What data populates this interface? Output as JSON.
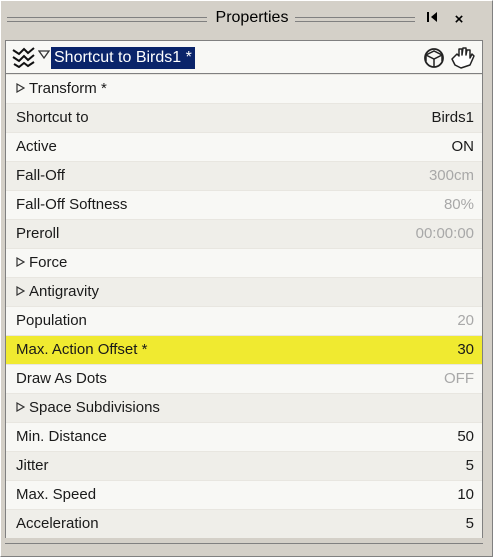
{
  "window": {
    "title": "Properties",
    "pin_label": "◀",
    "close_label": "×"
  },
  "object": {
    "name": "Shortcut to Birds1 *",
    "icon": "flock-icon",
    "tools_icon": "hand-icon"
  },
  "rows": [
    {
      "label": "Transform *",
      "value": "",
      "group": true
    },
    {
      "label": "Shortcut to",
      "value": "Birds1"
    },
    {
      "label": "Active",
      "value": "ON"
    },
    {
      "label": "Fall-Off",
      "value": "300cm",
      "dim": true
    },
    {
      "label": "Fall-Off Softness",
      "value": "80%",
      "dim": true
    },
    {
      "label": "Preroll",
      "value": "00:00:00",
      "dim": true
    },
    {
      "label": "Force",
      "value": "",
      "group": true
    },
    {
      "label": "Antigravity",
      "value": "",
      "group": true
    },
    {
      "label": "Population",
      "value": "20",
      "dim": true
    },
    {
      "label": "Max. Action Offset *",
      "value": "30",
      "highlight": true
    },
    {
      "label": "Draw As Dots",
      "value": "OFF",
      "dim": true
    },
    {
      "label": "Space Subdivisions",
      "value": "",
      "group": true
    },
    {
      "label": "Min. Distance",
      "value": "50"
    },
    {
      "label": "Jitter",
      "value": "5"
    },
    {
      "label": "Max. Speed",
      "value": "10"
    },
    {
      "label": "Acceleration",
      "value": "5"
    }
  ],
  "colors": {
    "highlight": "#f0ea30",
    "selection": "#0a246a",
    "dim_text": "#a8a8a8"
  }
}
